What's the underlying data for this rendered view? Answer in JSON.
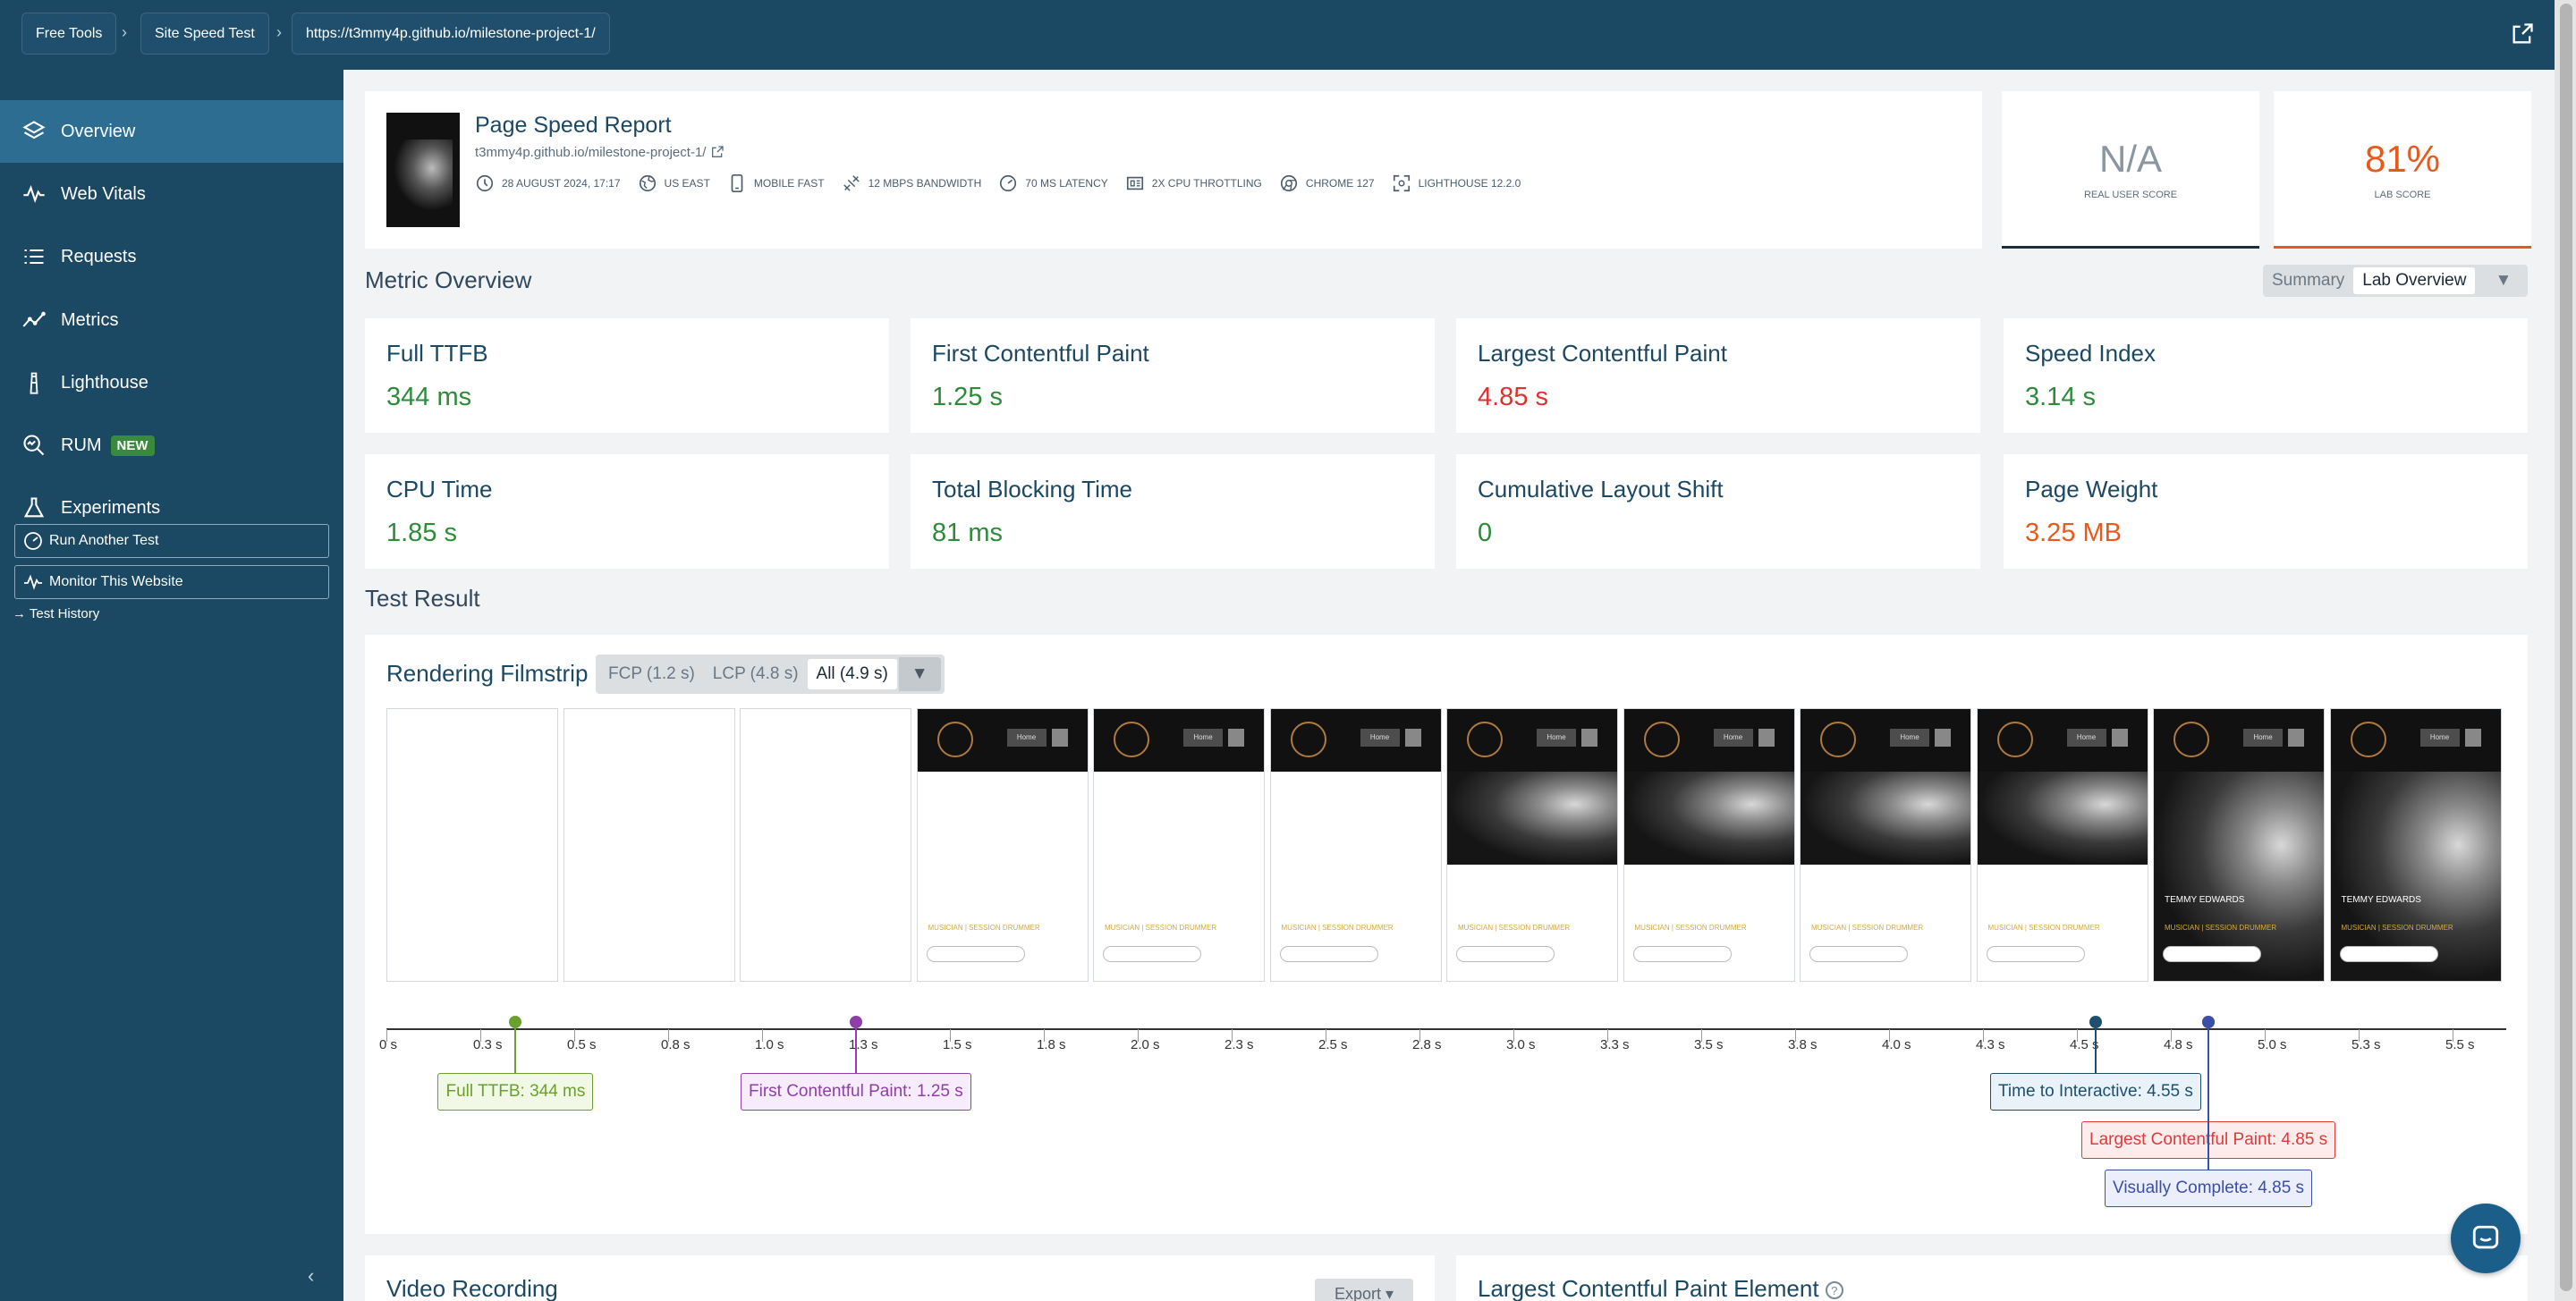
{
  "breadcrumb": [
    "Free Tools",
    "Site Speed Test",
    "https://t3mmy4p.github.io/milestone-project-1/"
  ],
  "sidebar": {
    "items": [
      {
        "label": "Overview",
        "icon": "layers-icon"
      },
      {
        "label": "Web Vitals",
        "icon": "pulse-icon"
      },
      {
        "label": "Requests",
        "icon": "list-icon"
      },
      {
        "label": "Metrics",
        "icon": "line-chart-icon"
      },
      {
        "label": "Lighthouse",
        "icon": "lighthouse-icon"
      },
      {
        "label": "RUM",
        "icon": "search-icon",
        "badge": "NEW"
      },
      {
        "label": "Experiments",
        "icon": "flask-icon"
      }
    ],
    "actions": [
      "Run Another Test",
      "Monitor This Website"
    ],
    "history_link": "Test History"
  },
  "report": {
    "title": "Page Speed Report",
    "url": "t3mmy4p.github.io/milestone-project-1/",
    "meta": [
      "28 August 2024, 17:17",
      "US East",
      "Mobile Fast",
      "12 Mbps bandwidth",
      "70 ms latency",
      "2x CPU throttling",
      "Chrome 127",
      "Lighthouse 12.2.0"
    ]
  },
  "scores": {
    "real_user": {
      "value": "N/A",
      "label": "Real User Score"
    },
    "lab": {
      "value": "81%",
      "label": "Lab Score"
    }
  },
  "metric_overview": {
    "title": "Metric Overview",
    "toggle": [
      "Summary",
      "Lab Overview"
    ],
    "metrics": [
      {
        "name": "Full TTFB",
        "value": "344 ms",
        "status": "good"
      },
      {
        "name": "First Contentful Paint",
        "value": "1.25 s",
        "status": "good"
      },
      {
        "name": "Largest Contentful Paint",
        "value": "4.85 s",
        "status": "poor"
      },
      {
        "name": "Speed Index",
        "value": "3.14 s",
        "status": "good"
      },
      {
        "name": "CPU Time",
        "value": "1.85 s",
        "status": "good"
      },
      {
        "name": "Total Blocking Time",
        "value": "81 ms",
        "status": "good"
      },
      {
        "name": "Cumulative Layout Shift",
        "value": "0",
        "status": "good"
      },
      {
        "name": "Page Weight",
        "value": "3.25 MB",
        "status": "warn"
      }
    ]
  },
  "test_result": {
    "title": "Test Result",
    "filmstrip": {
      "title": "Rendering Filmstrip",
      "tabs": [
        "FCP (1.2 s)",
        "LCP (4.8 s)",
        "All (4.9 s)"
      ],
      "frame_text": {
        "home": "Home",
        "caption": "MUSICIAN | SESSION DRUMMER",
        "name": "TEMMY EDWARDS"
      },
      "ticks": [
        "0 s",
        "0.3 s",
        "0.5 s",
        "0.8 s",
        "1.0 s",
        "1.3 s",
        "1.5 s",
        "1.8 s",
        "2.0 s",
        "2.3 s",
        "2.5 s",
        "2.8 s",
        "3.0 s",
        "3.3 s",
        "3.5 s",
        "3.8 s",
        "4.0 s",
        "4.3 s",
        "4.5 s",
        "4.8 s",
        "5.0 s",
        "5.3 s",
        "5.5 s"
      ],
      "markers": [
        {
          "label": "Full TTFB: 344 ms",
          "time": 0.344
        },
        {
          "label": "First Contentful Paint: 1.25 s",
          "time": 1.25
        },
        {
          "label": "Time to Interactive: 4.55 s",
          "time": 4.55
        },
        {
          "label": "Largest Contentful Paint: 4.85 s",
          "time": 4.85
        },
        {
          "label": "Visually Complete: 4.85 s",
          "time": 4.85
        }
      ]
    }
  },
  "bottom": {
    "video_title": "Video Recording",
    "export_label": "Export",
    "lcp_title": "Largest Contentful Paint Element"
  },
  "colors": {
    "good": "#2e8b3a",
    "poor": "#e03030",
    "warn": "#e85a1c",
    "brand": "#1b4863"
  }
}
